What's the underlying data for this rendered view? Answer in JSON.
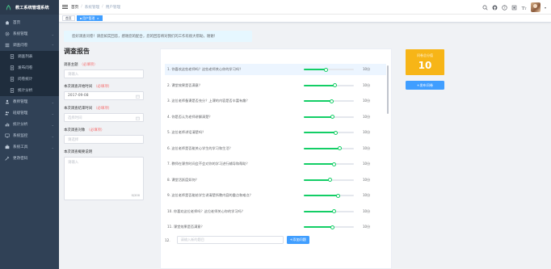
{
  "app": {
    "name": "教工系统管理系统"
  },
  "sidebar": {
    "items": [
      {
        "label": "首页",
        "icon": "home-icon",
        "type": "item"
      },
      {
        "label": "系统管理",
        "icon": "gear-icon",
        "type": "group"
      },
      {
        "label": "调查问卷",
        "icon": "list-icon",
        "type": "group-open"
      },
      {
        "label": "调查列表",
        "icon": "doc-icon",
        "type": "sub"
      },
      {
        "label": "发布问卷",
        "icon": "doc-icon",
        "type": "sub"
      },
      {
        "label": "问卷统计",
        "icon": "doc-icon",
        "type": "sub"
      },
      {
        "label": "统计分析",
        "icon": "doc-icon",
        "type": "sub"
      },
      {
        "label": "教师管理",
        "icon": "user-icon",
        "type": "group"
      },
      {
        "label": "班级管理",
        "icon": "users-icon",
        "type": "group"
      },
      {
        "label": "统计分析",
        "icon": "chart-icon",
        "type": "group"
      },
      {
        "label": "系统监控",
        "icon": "monitor-icon",
        "type": "group"
      },
      {
        "label": "系统工具",
        "icon": "tool-icon",
        "type": "group"
      },
      {
        "label": "更改密码",
        "icon": "key-icon",
        "type": "item"
      }
    ]
  },
  "header": {
    "breadcrumb": [
      "首页",
      "系统管理",
      "用户管理"
    ]
  },
  "tags": [
    {
      "label": "首页",
      "active": false
    },
    {
      "label": "用户管理",
      "active": true
    }
  ],
  "notice": "您好调查问卷！请您如实回答，感谢您的配合，您的回答将对我们的工作有很大帮助，谢谢！",
  "form": {
    "title": "调查报告",
    "fields": [
      {
        "label": "调查主题",
        "required": "（必填项）",
        "placeholder": "请输入",
        "value": "",
        "type": "text"
      },
      {
        "label": "本次调查开始时间",
        "required": "（必填项）",
        "placeholder": "",
        "value": "2017-09-08",
        "type": "date"
      },
      {
        "label": "本次调查结束时间",
        "required": "（必填项）",
        "placeholder": "选择时间",
        "value": "",
        "type": "date"
      },
      {
        "label": "本次调查对象",
        "required": "（必填项）",
        "placeholder": "请选择",
        "value": "",
        "type": "select"
      },
      {
        "label": "本次调查概要说明",
        "required": "",
        "placeholder": "请输入",
        "value": "",
        "type": "textarea",
        "count": "0/200"
      }
    ]
  },
  "survey": {
    "questions": [
      {
        "text": "1. 你喜欢这些老师吗？这些老师关心你的学习吗？",
        "value": 0.45,
        "score": "10分",
        "highlight": true
      },
      {
        "text": "2. 课堂效果是否满意？",
        "value": 0.62,
        "score": "10分"
      },
      {
        "text": "3. 这位老师备课是否充分？上课的内容是否丰富有趣？",
        "value": 0.55,
        "score": "10分"
      },
      {
        "text": "4. 你是否认为老师讲解清楚？",
        "value": 0.58,
        "score": "10分"
      },
      {
        "text": "5. 这位老师讲话清楚吗？",
        "value": 0.63,
        "score": "10分"
      },
      {
        "text": "6. 这位老师是否能关心学生的学习和生活？",
        "value": 0.72,
        "score": "10分"
      },
      {
        "text": "7. 教师在课余时间会不会对你的学习进行辅导和帮助？",
        "value": 0.6,
        "score": "10分"
      },
      {
        "text": "8. 课堂活跃度如何？",
        "value": 0.53,
        "score": "10分"
      },
      {
        "text": "9. 这位老师是否能给学生讲清楚所教内容的重点和难点？",
        "value": 0.68,
        "score": "10分"
      },
      {
        "text": "10. 你喜欢这位老师吗？这位老师关心你的学习吗？",
        "value": 0.6,
        "score": "10分"
      },
      {
        "text": "11. 课堂效果是否满意？",
        "value": 0.57,
        "score": "10分"
      }
    ],
    "add": {
      "label": "12.",
      "placeholder": "请输入新的题目",
      "button": "+添加问题"
    }
  },
  "score": {
    "label": "问卷总分值",
    "value": "10"
  },
  "submit_label": "+发布问卷",
  "colors": {
    "sidebar": "#304156",
    "accent": "#409eff",
    "score": "#f7b517",
    "slider": "#13ce66"
  }
}
